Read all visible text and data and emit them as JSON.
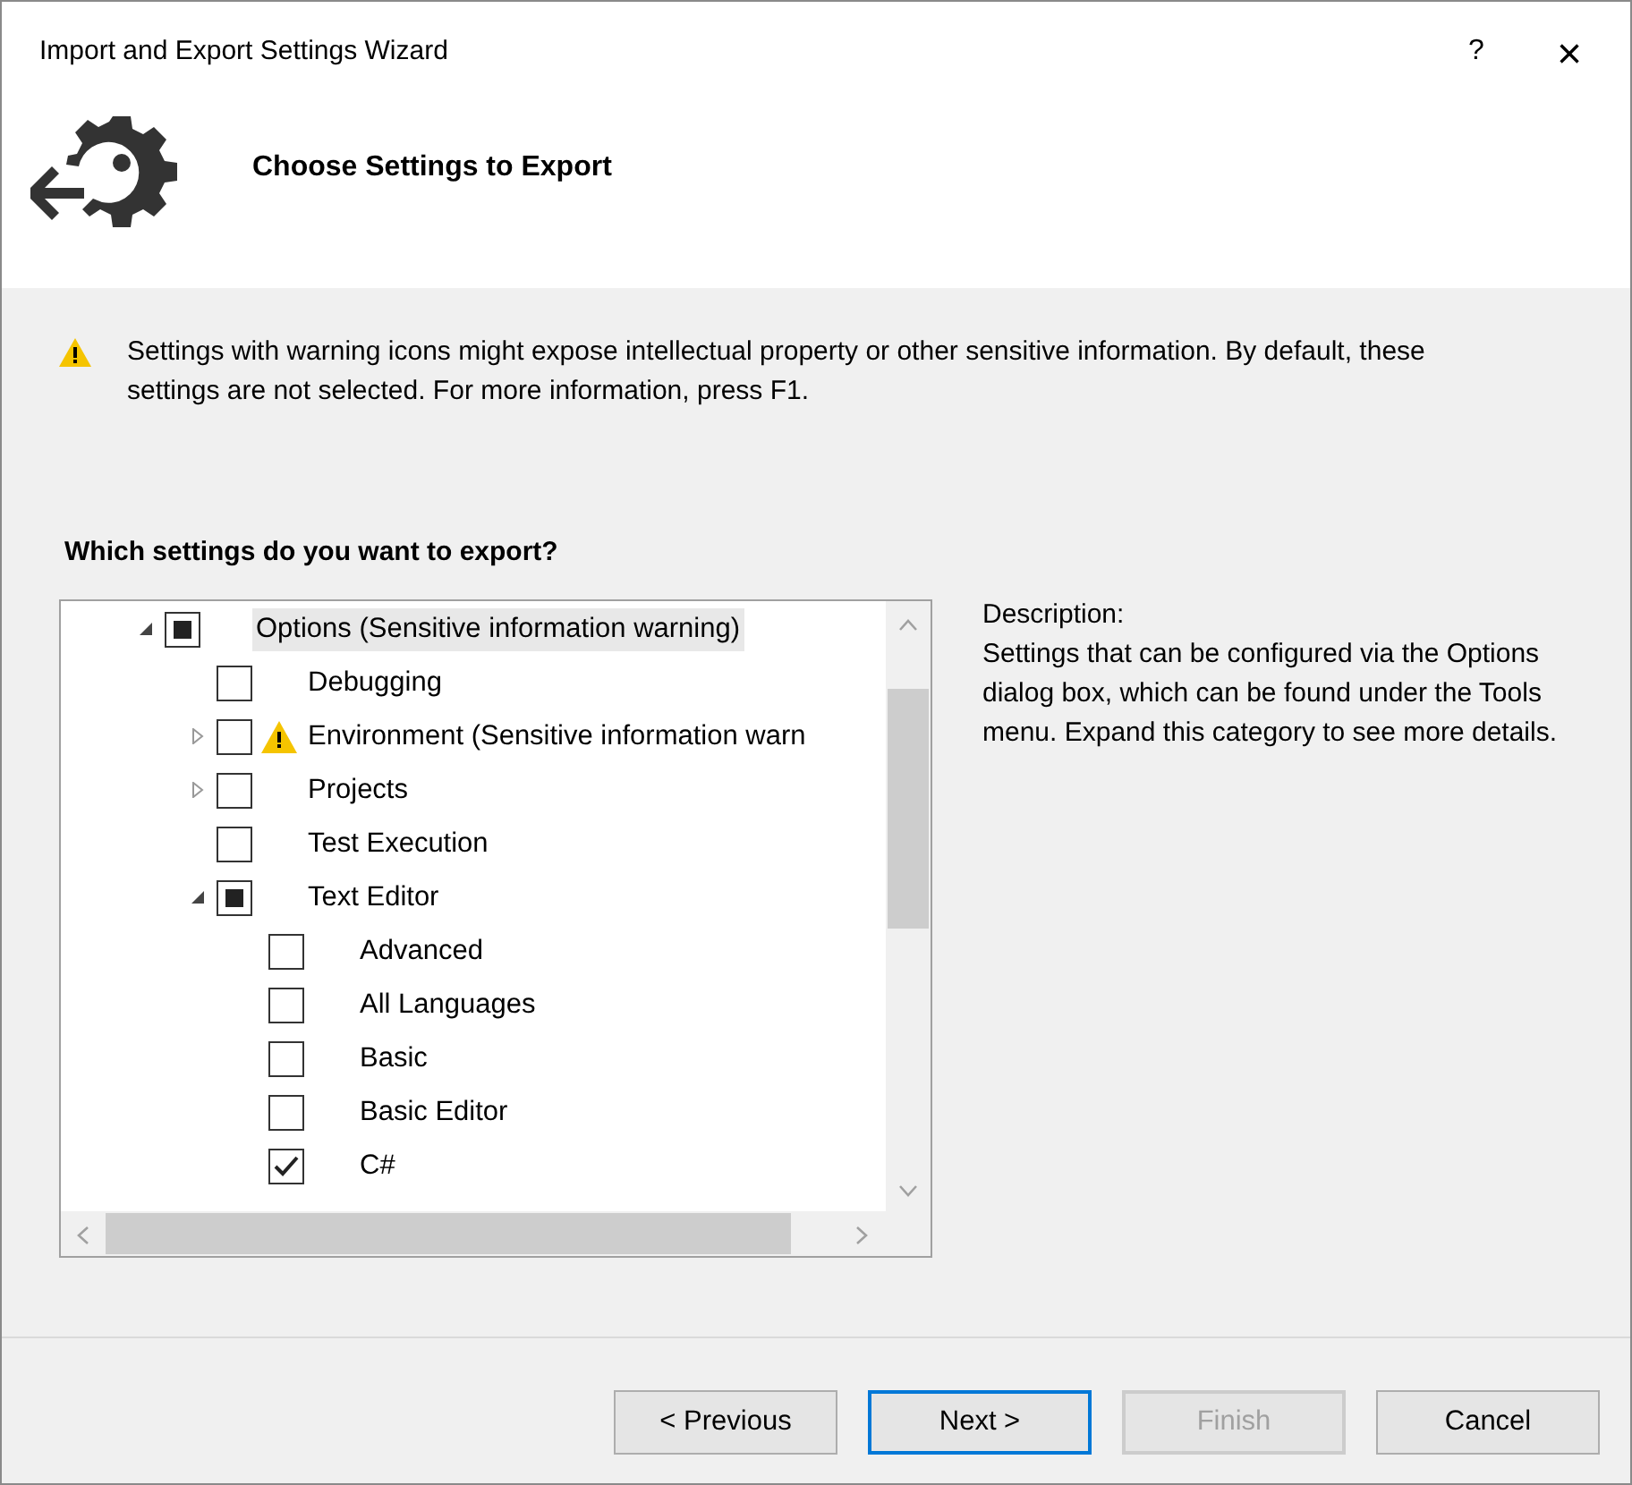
{
  "window": {
    "title": "Import and Export Settings Wizard",
    "help": "?",
    "close": "×"
  },
  "header": {
    "title": "Choose Settings to Export"
  },
  "warning": {
    "text": "Settings with warning icons might expose intellectual property or other sensitive information. By default, these settings are not selected. For more information, press F1."
  },
  "tree": {
    "label": "Which settings do you want to export?",
    "items": [
      {
        "label": "Options (Sensitive information warning)",
        "checked": false,
        "indeterminate": true,
        "warning": false,
        "expanded": true,
        "selected": true,
        "children": [
          {
            "label": "Debugging",
            "checked": false,
            "indeterminate": false,
            "warning": false,
            "selected": false
          },
          {
            "label": "Environment (Sensitive information warn",
            "checked": false,
            "indeterminate": false,
            "warning": true,
            "expanded": false,
            "selected": false
          },
          {
            "label": "Projects",
            "checked": false,
            "indeterminate": false,
            "warning": false,
            "expanded": false,
            "selected": false
          },
          {
            "label": "Test Execution",
            "checked": false,
            "indeterminate": false,
            "warning": false,
            "selected": false
          },
          {
            "label": "Text Editor",
            "checked": false,
            "indeterminate": true,
            "warning": false,
            "expanded": true,
            "selected": false,
            "children": [
              {
                "label": "Advanced",
                "checked": false,
                "indeterminate": false,
                "warning": false,
                "selected": false
              },
              {
                "label": "All Languages",
                "checked": false,
                "indeterminate": false,
                "warning": false,
                "selected": false
              },
              {
                "label": "Basic",
                "checked": false,
                "indeterminate": false,
                "warning": false,
                "selected": false
              },
              {
                "label": "Basic Editor",
                "checked": false,
                "indeterminate": false,
                "warning": false,
                "selected": false
              },
              {
                "label": "C#",
                "checked": true,
                "indeterminate": false,
                "warning": false,
                "selected": false
              }
            ]
          }
        ]
      }
    ]
  },
  "description": {
    "label": "Description:",
    "text": "Settings that can be configured via the Options dialog box, which can be found under the Tools menu. Expand this category to see more details."
  },
  "buttons": [
    {
      "label": "< Previous",
      "kind": "normal",
      "disabled": false
    },
    {
      "label": "Next >",
      "kind": "default",
      "disabled": false
    },
    {
      "label": "Finish",
      "kind": "normal",
      "disabled": true
    },
    {
      "label": "Cancel",
      "kind": "normal",
      "disabled": false
    }
  ]
}
